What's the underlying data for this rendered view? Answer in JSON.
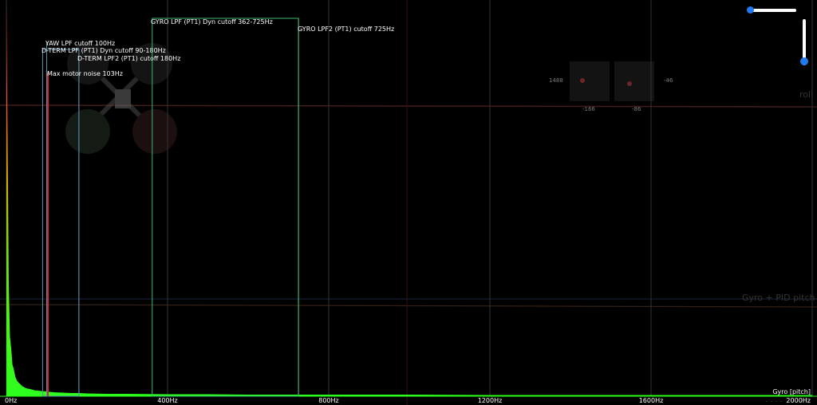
{
  "chart_data": {
    "type": "area",
    "title": "",
    "xlabel": "",
    "ylabel": "",
    "series_label": "Gyro [pitch]",
    "xlim": [
      0,
      2000
    ],
    "x_ticks": [
      {
        "value": 0,
        "label": "0Hz"
      },
      {
        "value": 400,
        "label": "400Hz"
      },
      {
        "value": 800,
        "label": "800Hz"
      },
      {
        "value": 1200,
        "label": "1200Hz"
      },
      {
        "value": 1600,
        "label": "1600Hz"
      },
      {
        "value": 2000,
        "label": "2000Hz"
      }
    ],
    "ylim": [
      0,
      1
    ],
    "spectrum": {
      "x": [
        0,
        3,
        6,
        9,
        12,
        15,
        18,
        22,
        26,
        30,
        35,
        40,
        50,
        60,
        70,
        80,
        90,
        100,
        110,
        120,
        140,
        160,
        180,
        200,
        250,
        300,
        400,
        500,
        600,
        800,
        1000,
        1200,
        1400,
        1600,
        1800,
        2000
      ],
      "y": [
        1.0,
        0.66,
        0.28,
        0.15,
        0.12,
        0.08,
        0.07,
        0.05,
        0.04,
        0.035,
        0.03,
        0.025,
        0.02,
        0.018,
        0.015,
        0.014,
        0.013,
        0.012,
        0.011,
        0.01,
        0.009,
        0.008,
        0.008,
        0.007,
        0.006,
        0.006,
        0.005,
        0.005,
        0.004,
        0.004,
        0.004,
        0.003,
        0.003,
        0.003,
        0.003,
        0.003
      ]
    },
    "markers": [
      {
        "name": "YAW LPF cutoff 100Hz",
        "hz": 100,
        "color": "#5a8fa8"
      },
      {
        "name": "D-TERM LPF (PT1) Dyn cutoff 90-180Hz",
        "hz": 90,
        "hz_end": 180,
        "color": "#5a8fa8"
      },
      {
        "name": "D-TERM LPF2 (PT1) cutoff 180Hz",
        "hz": 180,
        "color": "#5a8fa8"
      },
      {
        "name": "Max motor noise 103Hz",
        "hz": 103,
        "color": "#d2283c"
      },
      {
        "name": "GYRO LPF (PT1) Dyn cutoff 362-725Hz",
        "hz": 362,
        "hz_end": 725,
        "color": "#3cb878"
      },
      {
        "name": "GYRO LPF2 (PT1) cutoff 725Hz",
        "hz": 725,
        "color": "#3cb878"
      }
    ]
  },
  "background": {
    "roll_label": "roll",
    "pid_label": "Gyro + PID pitch",
    "sticks": {
      "left_top": "1488",
      "right_top": "-46",
      "left_bottom": "-166",
      "right_bottom": "-86"
    }
  },
  "controls": {
    "h_slider_value": 0.0,
    "v_slider_value": 1.0,
    "info": "- - - -"
  }
}
